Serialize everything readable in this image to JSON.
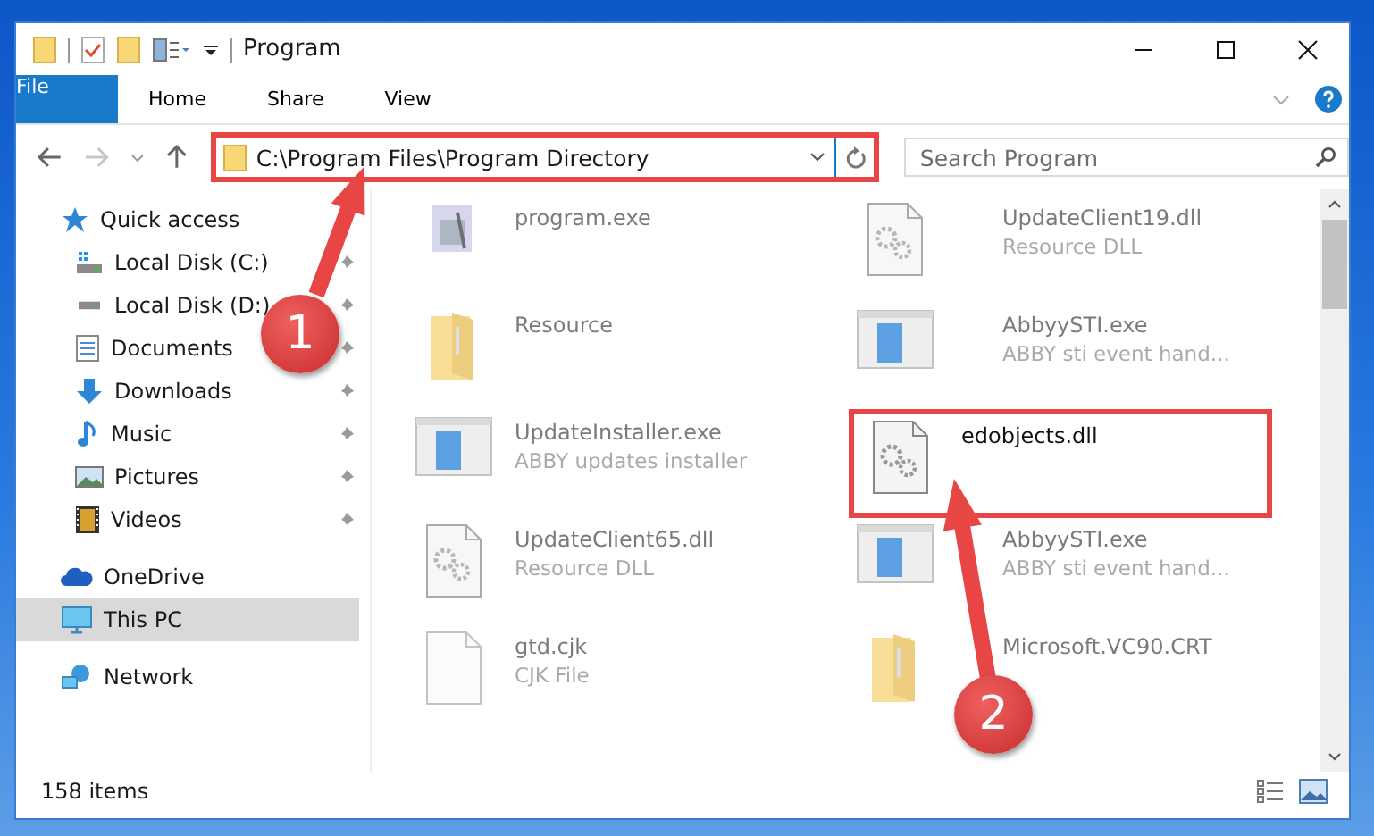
{
  "window": {
    "title": "Program"
  },
  "ribbon_tabs": [
    {
      "label": "File",
      "kind": "file",
      "selected": false
    },
    {
      "label": "Home",
      "kind": "tab",
      "selected": false
    },
    {
      "label": "Share",
      "kind": "tab",
      "selected": false
    },
    {
      "label": "View",
      "kind": "tab",
      "selected": false
    }
  ],
  "address": {
    "path": "C:\\Program Files\\Program Directory",
    "highlighted": true
  },
  "search": {
    "placeholder": "Search Program"
  },
  "sidebar": {
    "items": [
      {
        "label": "Quick access",
        "selected": false,
        "children": [
          {
            "label": "Local Disk (C:)",
            "pinned": true
          },
          {
            "label": "Local Disk (D:)",
            "pinned": true
          },
          {
            "label": "Documents",
            "pinned": true
          },
          {
            "label": "Downloads",
            "pinned": true
          },
          {
            "label": "Music",
            "pinned": true
          },
          {
            "label": "Pictures",
            "pinned": true
          },
          {
            "label": "Videos",
            "pinned": true
          }
        ]
      },
      {
        "label": "OneDrive",
        "selected": false
      },
      {
        "label": "This PC",
        "selected": true
      },
      {
        "label": "Network",
        "selected": false
      }
    ]
  },
  "files": [
    {
      "name": "program.exe",
      "kind": "exe",
      "blurred": true,
      "highlighted": false
    },
    {
      "name": "UpdateClient19.dll",
      "description": "Resource DLL",
      "kind": "dll",
      "blurred": true,
      "highlighted": false
    },
    {
      "name": "Resource",
      "kind": "folder",
      "blurred": true,
      "highlighted": false
    },
    {
      "name": "AbbyySTI.exe",
      "description": "ABBY sti event hand...",
      "kind": "app",
      "blurred": true,
      "highlighted": false
    },
    {
      "name": "UpdateInstaller.exe",
      "description": "ABBY updates installer",
      "kind": "app",
      "blurred": true,
      "highlighted": false
    },
    {
      "name": "edobjects.dll",
      "kind": "dll",
      "blurred": false,
      "highlighted": true
    },
    {
      "name": "UpdateClient65.dll",
      "description": "Resource DLL",
      "kind": "dll",
      "blurred": true,
      "highlighted": false
    },
    {
      "name": "AbbyySTI.exe",
      "description": "ABBY sti event hand...",
      "kind": "app",
      "blurred": true,
      "highlighted": false
    },
    {
      "name": "gtd.cjk",
      "description": "CJK File",
      "kind": "file",
      "blurred": true,
      "highlighted": false
    },
    {
      "name": "Microsoft.VC90.CRT",
      "kind": "folder",
      "blurred": true,
      "highlighted": false
    }
  ],
  "status_bar": {
    "item_count": "158 items"
  },
  "annotations": [
    {
      "label": "1"
    },
    {
      "label": "2"
    }
  ]
}
